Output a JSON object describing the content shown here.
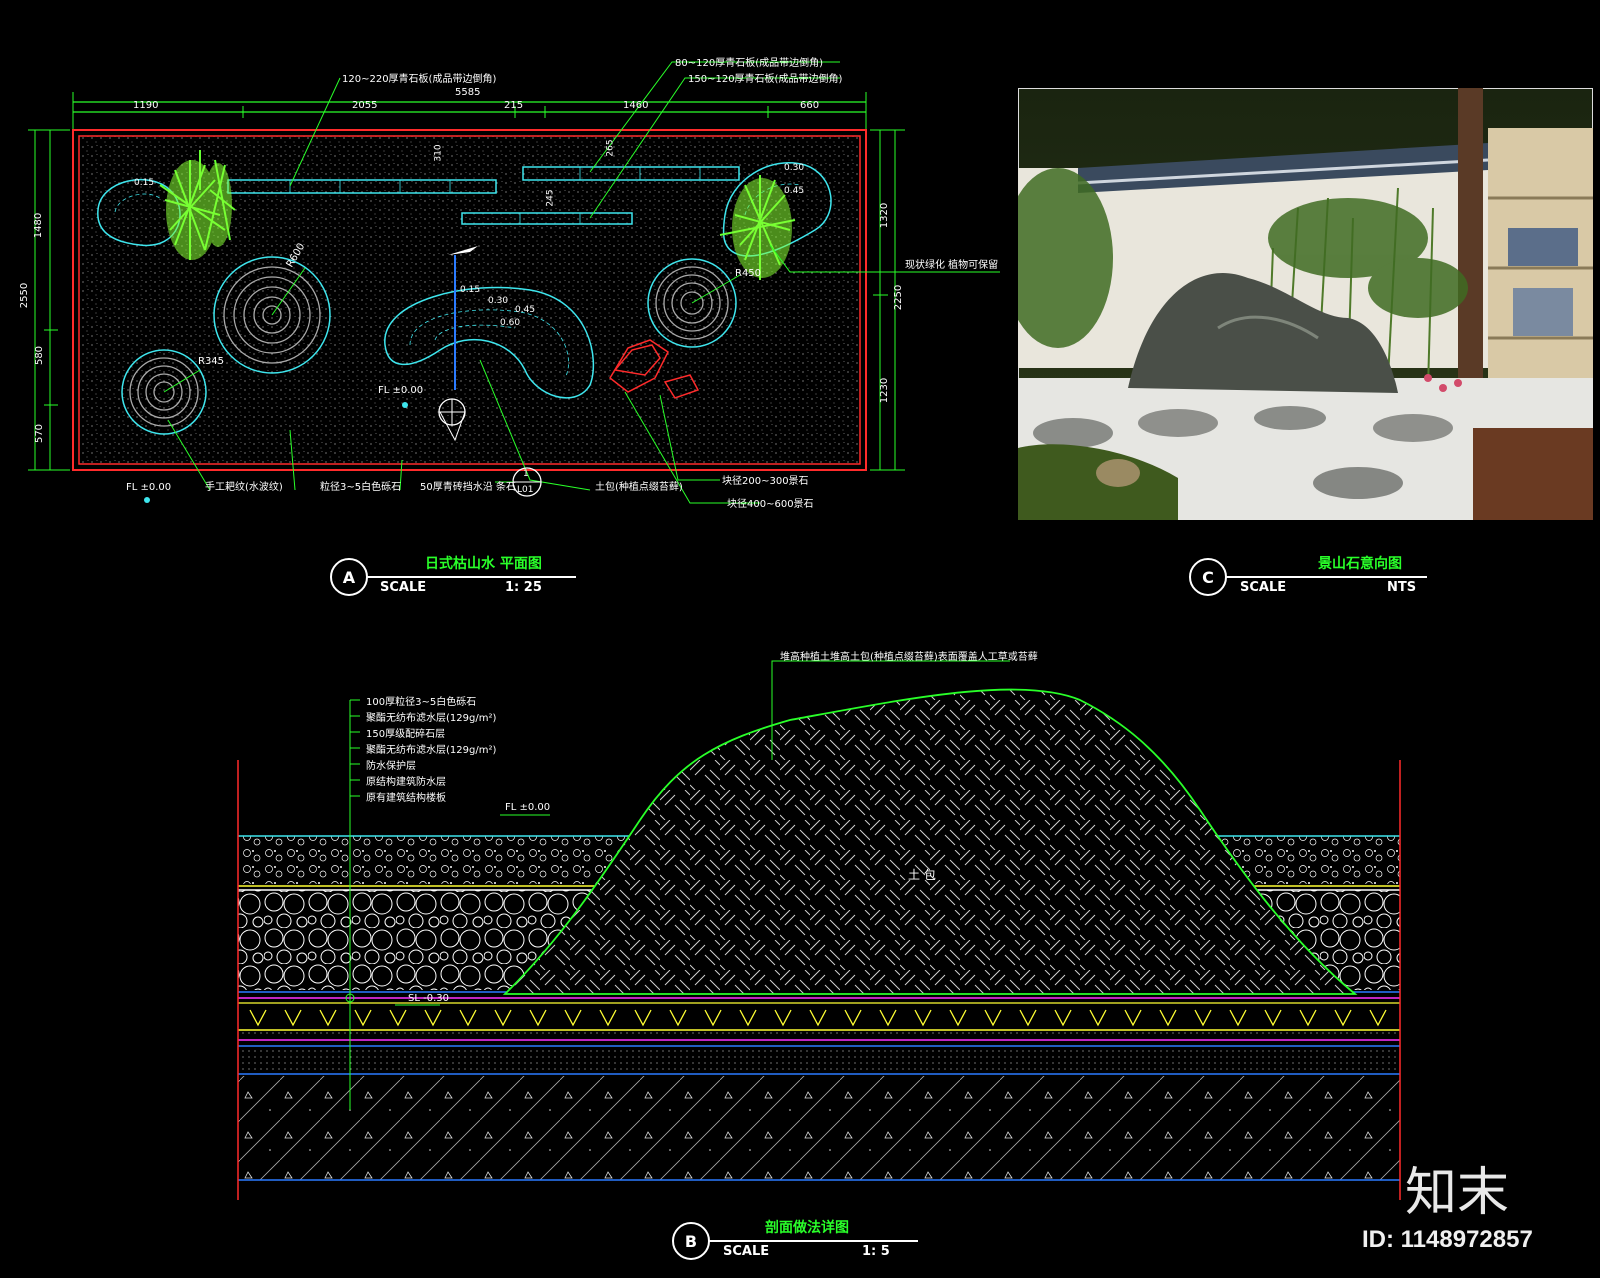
{
  "plan": {
    "title": "日式枯山水 平面图",
    "tag": "A",
    "scale_label": "SCALE",
    "scale_value": "1: 25",
    "dims_top": [
      "1190",
      "2055",
      "215",
      "1460",
      "660"
    ],
    "dim_total": "5585",
    "dims_left": [
      "1480",
      "2550",
      "580",
      "570"
    ],
    "dims_right": [
      "1320",
      "2250",
      "1230"
    ],
    "callouts_top": [
      "120~220厚青石板(成品带边倒角)",
      "80~120厚青石板(成品带边倒角)",
      "150~120厚青石板(成品带边倒角)"
    ],
    "callout_right": "现状绿化 植物可保留",
    "callouts_bottom": [
      "手工耙纹(水波纹)",
      "粒径3~5白色砾石",
      "50厚青砖挡水沿 条石",
      "土包(种植点缀苔藓)",
      "块径200~300景石",
      "块径400~600景石"
    ],
    "fl_marks": [
      "FL ±0.00",
      "FL ±0.00"
    ],
    "radius_labels": [
      "R600",
      "R345",
      "R450"
    ],
    "mound_labels": [
      "0.15",
      "0.30",
      "0.45",
      "0.60"
    ],
    "small_dims": [
      "310",
      "265",
      "245",
      "0.15",
      "0.30",
      "0.45"
    ],
    "section_marker": {
      "num": "1",
      "sheet": "L01"
    }
  },
  "photo": {
    "title": "景山石意向图",
    "tag": "C",
    "scale_label": "SCALE",
    "scale_value": "NTS"
  },
  "section": {
    "title": "剖面做法详图",
    "tag": "B",
    "scale_label": "SCALE",
    "scale_value": "1: 5",
    "layers": [
      "100厚粒径3~5白色砾石",
      "聚酯无纺布滤水层(129g/m²)",
      "150厚级配碎石层",
      "聚酯无纺布滤水层(129g/m²)",
      "防水保护层",
      "原结构建筑防水层",
      "原有建筑结构楼板"
    ],
    "mound_note": "堆高种植土堆高土包(种植点缀苔藓)表面覆盖人工草或苔藓",
    "fill_label": "土 包",
    "fl_mark": "FL ±0.00",
    "sl_mark": "SL -0.30"
  },
  "watermark": {
    "brand": "知末",
    "id": "ID: 1148972857"
  },
  "colors": {
    "green": "#29ff29",
    "cyan": "#3ee6ee",
    "red": "#ff2b2b",
    "yellow": "#ffff33",
    "blue": "#2b7bff",
    "magenta": "#ff33ff"
  }
}
